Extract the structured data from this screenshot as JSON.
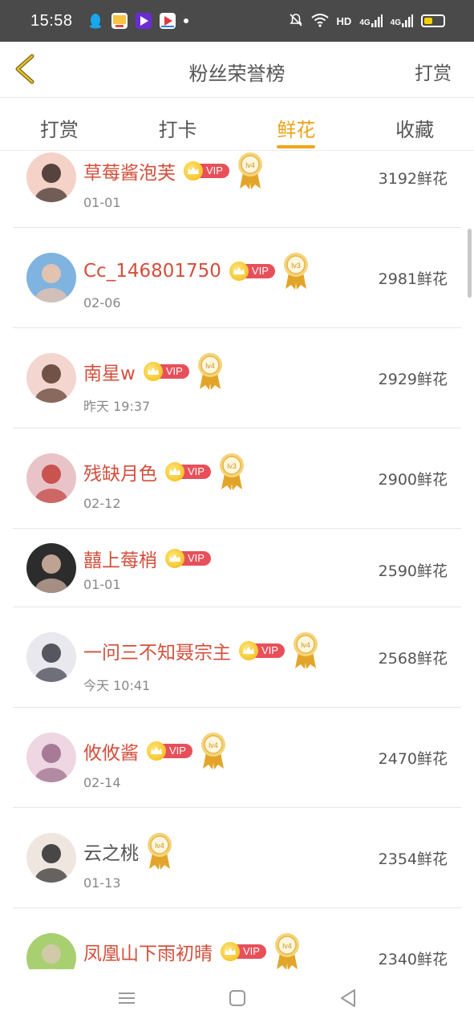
{
  "status_bar": {
    "time": "15:58",
    "network": "HD",
    "signal1": "4G",
    "signal2": "4G",
    "app_icons": [
      "qq-icon",
      "news-icon",
      "video-icon",
      "player-icon"
    ],
    "battery_level": 0.45
  },
  "header": {
    "title": "粉丝荣誉榜",
    "action": "打赏"
  },
  "tabs": [
    {
      "label": "打赏",
      "active": false
    },
    {
      "label": "打卡",
      "active": false
    },
    {
      "label": "鲜花",
      "active": true
    },
    {
      "label": "收藏",
      "active": false
    }
  ],
  "fans": [
    {
      "name": "草莓酱泡芙",
      "vip": true,
      "level": "lv4",
      "date": "01-01",
      "amount": "3192鲜花"
    },
    {
      "name": "Cc_146801750",
      "vip": true,
      "level": "lv3",
      "date": "02-06",
      "amount": "2981鲜花"
    },
    {
      "name": "南星w",
      "vip": true,
      "level": "lv4",
      "date": "昨天 19:37",
      "amount": "2929鲜花"
    },
    {
      "name": "残缺月色",
      "vip": true,
      "level": "lv3",
      "date": "02-12",
      "amount": "2900鲜花"
    },
    {
      "name": "囍上莓梢",
      "vip": true,
      "level": null,
      "date": "01-01",
      "amount": "2590鲜花"
    },
    {
      "name": "一问三不知聂宗主",
      "vip": true,
      "level": "lv4",
      "date": "今天 10:41",
      "amount": "2568鲜花"
    },
    {
      "name": "攸攸酱",
      "vip": true,
      "level": "lv4",
      "date": "02-14",
      "amount": "2470鲜花"
    },
    {
      "name": "云之桃",
      "vip": false,
      "level": "lv4",
      "date": "01-13",
      "amount": "2354鲜花"
    },
    {
      "name": "凤凰山下雨初晴",
      "vip": true,
      "level": "lv4",
      "date": "",
      "amount": "2340鲜花"
    }
  ],
  "vip_label": "VIP",
  "colors": {
    "accent": "#f0a51b",
    "name_vip": "#d24f3c",
    "vip_badge": "#e7505a"
  }
}
